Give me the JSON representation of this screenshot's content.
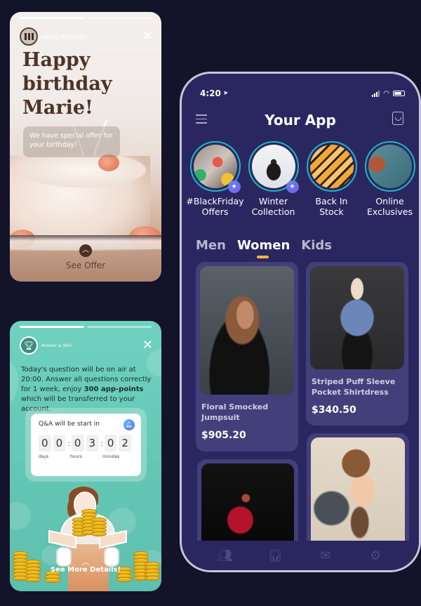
{
  "story_birthday": {
    "progress": [
      1,
      0
    ],
    "account_name": "happy Birthday!",
    "title": "Happy birthday Marie!",
    "message": "We have special offer for your birthday!",
    "cta_label": "See Offer",
    "icons": {
      "close": "close-icon",
      "cta": "chevron-up-icon"
    }
  },
  "story_qa": {
    "progress": [
      1,
      0
    ],
    "account_name": "Answer & Win!",
    "text_before": "Today's question will be on air at 20:00. Answer all questions correctly for 1 week, enjoy ",
    "text_bold": "300 app-points",
    "text_after": " which will be transferred to your account.",
    "countdown": {
      "title": "Q&A will be start in",
      "days": [
        "0",
        "0"
      ],
      "hours": [
        "0",
        "3"
      ],
      "minutes": [
        "0",
        "2"
      ],
      "labels": {
        "days": "days",
        "hours": "hours",
        "minutes": "minutes"
      }
    },
    "cta_label": "See More Details!",
    "icons": {
      "close": "close-icon",
      "avatar": "trophy-icon",
      "bell": "bell-icon",
      "cta": "chevron-up-icon"
    }
  },
  "phone": {
    "status": {
      "time": "4:20"
    },
    "header": {
      "title": "Your App"
    },
    "stories": [
      {
        "label_line1": "#BlackFriday",
        "label_line2": "Offers",
        "badge": true
      },
      {
        "label_line1": "Winter",
        "label_line2": "Collection",
        "badge": true
      },
      {
        "label_line1": "Back In",
        "label_line2": "Stock",
        "badge": false
      },
      {
        "label_line1": "Online",
        "label_line2": "Exclusives",
        "badge": false
      }
    ],
    "tabs": [
      {
        "label": "Men",
        "active": false
      },
      {
        "label": "Women",
        "active": true
      },
      {
        "label": "Kids",
        "active": false
      }
    ],
    "products": [
      {
        "name_line1": "Floral Smocked",
        "name_line2": "Jumpsuit",
        "price": "$905.20"
      },
      {
        "name_line1": "Striped Puff Sleeve",
        "name_line2": "Pocket Shirtdress",
        "price": "$340.50"
      },
      {
        "name_line1": "",
        "name_line2": "",
        "price": ""
      },
      {
        "name_line1": "",
        "name_line2": "",
        "price": ""
      }
    ],
    "tabbar": [
      "users-icon",
      "headset-icon",
      "mail-icon",
      "settings-icon"
    ]
  },
  "colors": {
    "background": "#13132a",
    "phone_bg": "#2a2760",
    "card_bg": "#433f7a",
    "accent_tab": "#f4b63c",
    "story_ring": "#1fb5c2",
    "qa_bg": "#6fd1c0",
    "birthday_title": "#4e3428"
  }
}
